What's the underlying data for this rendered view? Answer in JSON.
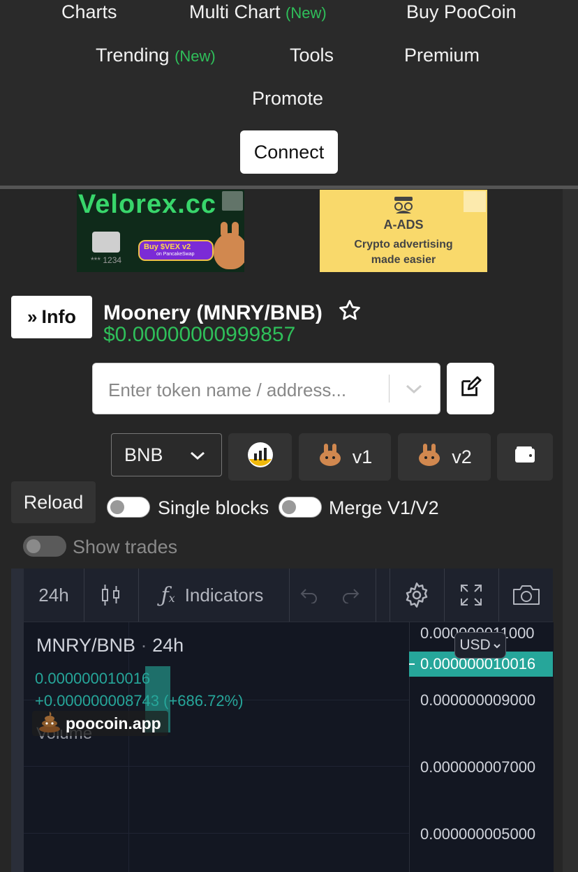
{
  "nav": {
    "charts": "Charts",
    "multi_chart": "Multi Chart",
    "multi_chart_badge": "(New)",
    "buy": "Buy PooCoin",
    "trending": "Trending",
    "trending_badge": "(New)",
    "tools": "Tools",
    "premium": "Premium",
    "promote": "Promote",
    "connect": "Connect"
  },
  "ads": {
    "ad1": {
      "brand": "Velorex.cc",
      "cta": "Buy $VEX v2",
      "sub": "on PancakeSwap",
      "card_number": "*** 1234"
    },
    "ad2": {
      "title": "A-ADS",
      "line1": "Crypto advertising",
      "line2": "made easier"
    }
  },
  "token": {
    "info_label": "Info",
    "name": "Moonery (MNRY/BNB)",
    "price": "$0.00000000999857"
  },
  "search": {
    "placeholder": "Enter token name / address..."
  },
  "controls": {
    "quote_select": "BNB",
    "v1_label": "v1",
    "v2_label": "v2",
    "reload": "Reload",
    "single_blocks": "Single blocks",
    "merge": "Merge V1/V2",
    "show_trades": "Show trades"
  },
  "chart_toolbar": {
    "interval": "24h",
    "indicators": "Indicators"
  },
  "chart": {
    "symbol": "MNRY/BNB",
    "interval": "24h",
    "legend_value": "0.000000010016",
    "legend_change": "+0.000000008743 (+686.72%)",
    "volume_label": "Volume",
    "watermark": "poocoin.app",
    "currency": "USD",
    "current_price_tag": "0.000000010016",
    "price_scale": [
      "0.000000011000",
      "0.000000009000",
      "0.000000007000",
      "0.000000005000"
    ],
    "up_color": "#26a69a"
  },
  "colors": {
    "accent_green": "#2fbf5a",
    "background": "#262626"
  }
}
